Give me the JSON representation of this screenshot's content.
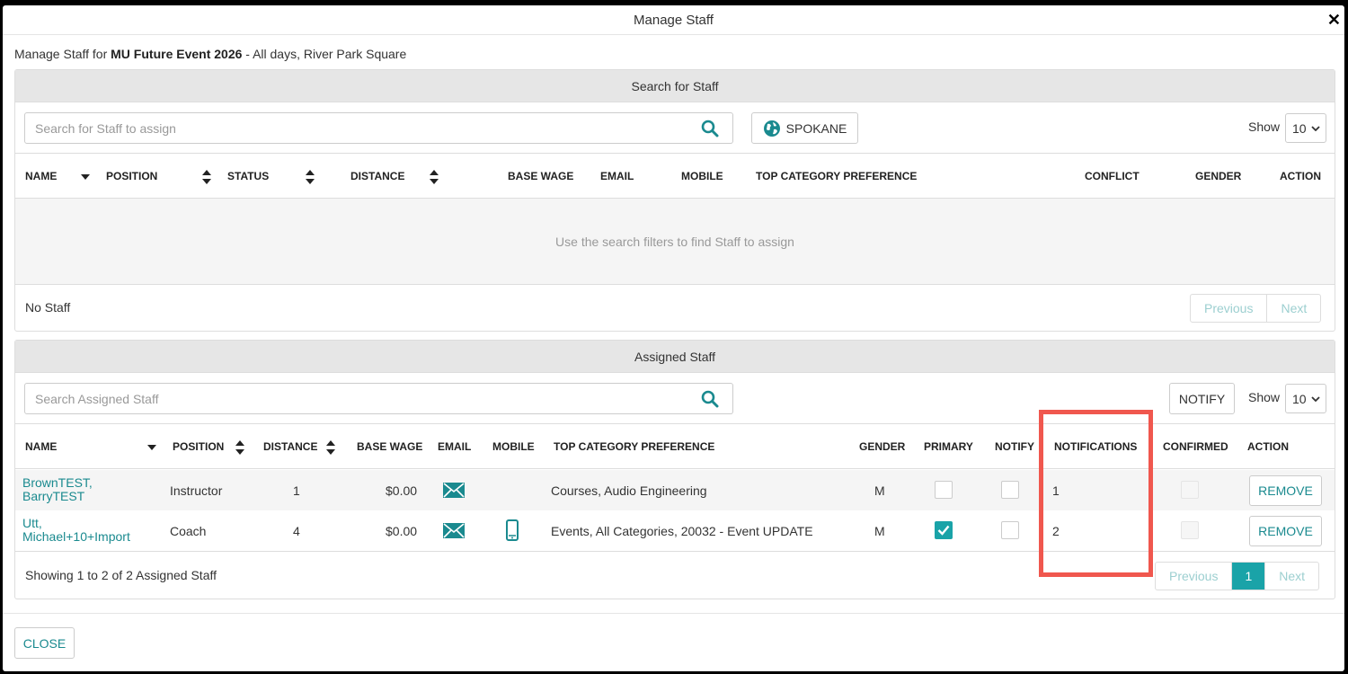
{
  "window": {
    "title": "Manage Staff"
  },
  "subtitle": {
    "prefix": "Manage Staff for ",
    "event": "MU Future Event 2026",
    "suffix": " - All days, River Park Square"
  },
  "search_panel": {
    "title": "Search for Staff",
    "search_placeholder": "Search for Staff to assign",
    "location_label": "SPOKANE",
    "show_label": "Show",
    "show_value": "10",
    "columns": [
      "NAME",
      "POSITION",
      "STATUS",
      "DISTANCE",
      "BASE WAGE",
      "EMAIL",
      "MOBILE",
      "TOP CATEGORY PREFERENCE",
      "CONFLICT",
      "GENDER",
      "ACTION"
    ],
    "empty_message": "Use the search filters to find Staff to assign",
    "footer_text": "No Staff",
    "pager": {
      "previous": "Previous",
      "next": "Next"
    }
  },
  "assigned_panel": {
    "title": "Assigned Staff",
    "search_placeholder": "Search Assigned Staff",
    "notify_label": "NOTIFY",
    "show_label": "Show",
    "show_value": "10",
    "columns": [
      "NAME",
      "POSITION",
      "DISTANCE",
      "BASE WAGE",
      "EMAIL",
      "MOBILE",
      "TOP CATEGORY PREFERENCE",
      "GENDER",
      "PRIMARY",
      "NOTIFY",
      "NOTIFICATIONS",
      "CONFIRMED",
      "ACTION"
    ],
    "rows": [
      {
        "name": "BrownTEST, BarryTEST",
        "position": "Instructor",
        "distance": "1",
        "base_wage": "$0.00",
        "category": "Courses, Audio Engineering",
        "gender": "M",
        "notifications": "1",
        "action": "REMOVE"
      },
      {
        "name": "Utt, Michael+10+Import",
        "position": "Coach",
        "distance": "4",
        "base_wage": "$0.00",
        "category": "Events, All Categories, 20032 - Event UPDATE",
        "gender": "M",
        "notifications": "2",
        "action": "REMOVE"
      }
    ],
    "footer_text": "Showing 1 to 2 of 2 Assigned Staff",
    "pager": {
      "previous": "Previous",
      "current": "1",
      "next": "Next"
    }
  },
  "footer": {
    "close_label": "CLOSE"
  },
  "colors": {
    "accent": "#1aa3a8",
    "link": "#1a8a8f",
    "highlight": "#f0574e"
  }
}
